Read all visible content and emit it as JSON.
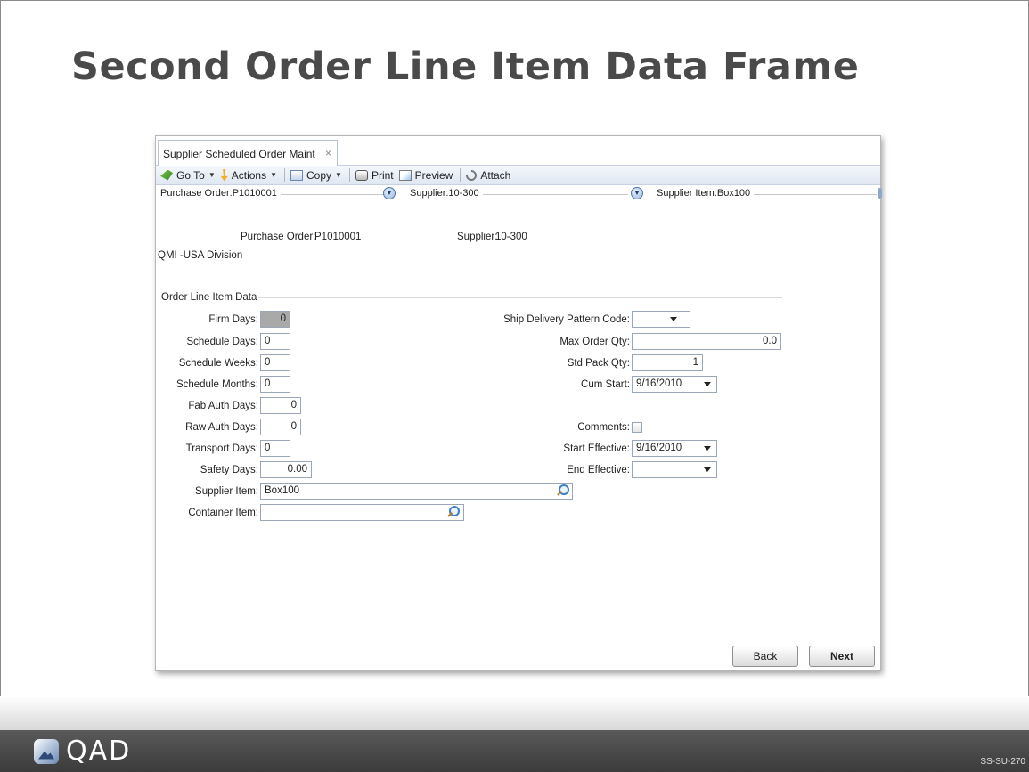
{
  "slide": {
    "title": "Second Order Line Item Data Frame",
    "slide_code": "SS-SU-270",
    "logo_text": "QAD"
  },
  "window": {
    "tab_label": "Supplier Scheduled Order Maint",
    "tab_close": "×"
  },
  "toolbar": {
    "goto": "Go To",
    "actions": "Actions",
    "copy": "Copy",
    "print": "Print",
    "preview": "Preview",
    "attach": "Attach"
  },
  "breadcrumb": {
    "purchase_order": "Purchase Order:P1010001",
    "supplier": "Supplier:10-300",
    "supplier_item": "Supplier Item:Box100"
  },
  "header": {
    "po_label": "Purchase Order:",
    "po_value": "P1010001",
    "supplier_label": "Supplier:",
    "supplier_value": "10-300",
    "division": "QMI -USA Division"
  },
  "section_title": "Order Line Item Data",
  "left_fields": {
    "firm_days": {
      "label": "Firm Days:",
      "value": "0"
    },
    "schedule_days": {
      "label": "Schedule Days:",
      "value": "0"
    },
    "schedule_weeks": {
      "label": "Schedule Weeks:",
      "value": "0"
    },
    "schedule_months": {
      "label": "Schedule Months:",
      "value": "0"
    },
    "fab_auth_days": {
      "label": "Fab Auth Days:",
      "value": "0"
    },
    "raw_auth_days": {
      "label": "Raw Auth Days:",
      "value": "0"
    },
    "transport_days": {
      "label": "Transport Days:",
      "value": "0"
    },
    "safety_days": {
      "label": "Safety Days:",
      "value": "0.00"
    },
    "supplier_item": {
      "label": "Supplier Item:",
      "value": "Box100"
    },
    "container_item": {
      "label": "Container Item:",
      "value": ""
    }
  },
  "right_fields": {
    "ship_delivery_pattern": {
      "label": "Ship Delivery Pattern Code:",
      "value": ""
    },
    "max_order_qty": {
      "label": "Max Order Qty:",
      "value": "0.0"
    },
    "std_pack_qty": {
      "label": "Std Pack Qty:",
      "value": "1"
    },
    "cum_start": {
      "label": "Cum Start:",
      "value": "9/16/2010"
    },
    "comments": {
      "label": "Comments:",
      "checked": false
    },
    "start_effective": {
      "label": "Start Effective:",
      "value": "9/16/2010"
    },
    "end_effective": {
      "label": "End Effective:",
      "value": ""
    }
  },
  "buttons": {
    "back": "Back",
    "next": "Next"
  }
}
